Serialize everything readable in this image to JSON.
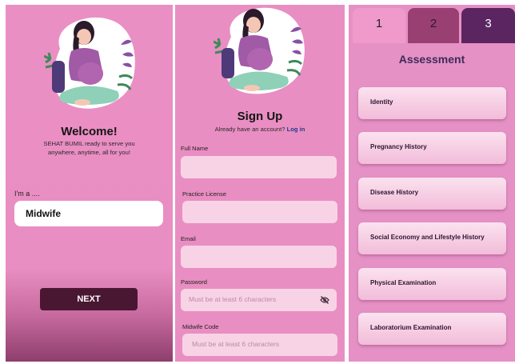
{
  "welcome": {
    "title": "Welcome!",
    "subtitle_line1": "SEHAT BUMIL ready to serve you",
    "subtitle_line2": "anywhere, anytime, all for you!",
    "role_label": "I'm a ....",
    "role_value": "Midwife",
    "next_label": "NEXT"
  },
  "signup": {
    "title": "Sign Up",
    "have_account_text": "Already have an account?",
    "login_link": "Log in",
    "fields": [
      {
        "label": "Full Name",
        "placeholder": ""
      },
      {
        "label": "Practice License",
        "placeholder": ""
      },
      {
        "label": "Email",
        "placeholder": ""
      },
      {
        "label": "Password",
        "placeholder": "Must be at least 6 characters"
      },
      {
        "label": "Midwife Code",
        "placeholder": "Must be at least 6 characters"
      }
    ]
  },
  "assessment": {
    "tabs": [
      "1",
      "2",
      "3"
    ],
    "title": "Assessment",
    "items": [
      "Identity",
      "Pregnancy History",
      "Disease History",
      "Social Economy and Lifestyle History",
      "Physical Examination",
      "Laboratorium Examination"
    ]
  },
  "colors": {
    "background_pink": "#e98ec2",
    "button_dark": "#4a1732",
    "link_blue": "#1d3a8a",
    "tab_active": "#ef9acb",
    "tab_mid": "#9a3f72",
    "tab_dark": "#5a2560"
  }
}
